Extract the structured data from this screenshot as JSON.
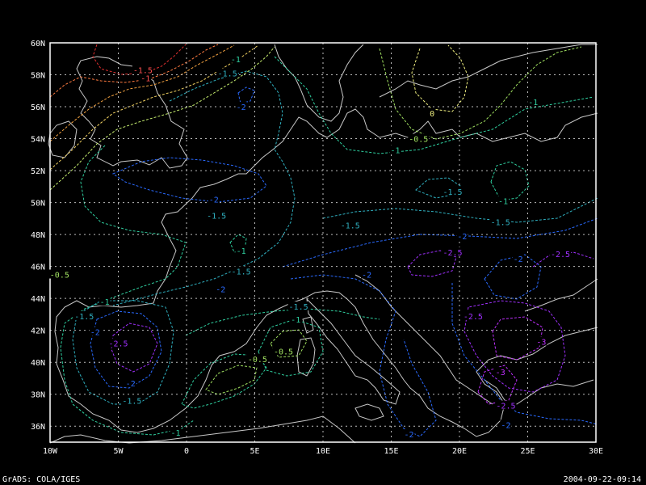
{
  "map": {
    "lon_labels": [
      "10W",
      "5W",
      "0",
      "5E",
      "10E",
      "15E",
      "20E",
      "25E",
      "30E"
    ],
    "lat_labels": [
      "60N",
      "58N",
      "56N",
      "54N",
      "52N",
      "50N",
      "48N",
      "46N",
      "44N",
      "42N",
      "40N",
      "38N",
      "36N"
    ],
    "contour_labels": [
      {
        "text": "-1.5",
        "color": "#ff5050",
        "lon": -3.2,
        "lat": 58.3
      },
      {
        "text": "-1",
        "color": "#ff5050",
        "lon": -3.0,
        "lat": 57.8
      },
      {
        "text": "-1",
        "color": "#2fd0a0",
        "lon": 3.6,
        "lat": 59.0
      },
      {
        "text": "-1.5",
        "color": "#2fb0c0",
        "lon": 3.0,
        "lat": 58.1
      },
      {
        "text": "-2",
        "color": "#2a6aff",
        "lon": 4.0,
        "lat": 56.0
      },
      {
        "text": "0",
        "color": "#f0f080",
        "lon": 18.0,
        "lat": 55.6
      },
      {
        "text": "-0.5",
        "color": "#a0e060",
        "lon": 17.0,
        "lat": 54.0
      },
      {
        "text": "-1",
        "color": "#2fd0a0",
        "lon": 15.3,
        "lat": 53.3
      },
      {
        "text": "-1",
        "color": "#2fd0a0",
        "lon": 25.4,
        "lat": 56.3
      },
      {
        "text": "-2",
        "color": "#2a6aff",
        "lon": 2.0,
        "lat": 50.2
      },
      {
        "text": "-1.5",
        "color": "#2fb0c0",
        "lon": 2.2,
        "lat": 49.2
      },
      {
        "text": "-1.5",
        "color": "#2fb0c0",
        "lon": 19.5,
        "lat": 50.7
      },
      {
        "text": "-1",
        "color": "#2fd0a0",
        "lon": 23.2,
        "lat": 50.1
      },
      {
        "text": "-1.5",
        "color": "#2fb0c0",
        "lon": 12.0,
        "lat": 48.6
      },
      {
        "text": "-1.5",
        "color": "#2fb0c0",
        "lon": 23.0,
        "lat": 48.8
      },
      {
        "text": "-2",
        "color": "#2a6aff",
        "lon": 20.2,
        "lat": 47.9
      },
      {
        "text": "-1",
        "color": "#2fd0a0",
        "lon": 4.0,
        "lat": 47.0
      },
      {
        "text": "-1.5",
        "color": "#2fb0c0",
        "lon": 4.0,
        "lat": 45.7
      },
      {
        "text": "-2.5",
        "color": "#a030ff",
        "lon": 19.5,
        "lat": 46.9
      },
      {
        "text": "-2",
        "color": "#2a6aff",
        "lon": 24.3,
        "lat": 46.5
      },
      {
        "text": "-2.5",
        "color": "#a030ff",
        "lon": 27.4,
        "lat": 46.8
      },
      {
        "text": "-0.5",
        "color": "#a0e060",
        "lon": -9.3,
        "lat": 45.5
      },
      {
        "text": "-2",
        "color": "#2a6aff",
        "lon": 13.2,
        "lat": 45.5
      },
      {
        "text": "-2",
        "color": "#2a6aff",
        "lon": 2.5,
        "lat": 44.6
      },
      {
        "text": "-1",
        "color": "#2fd0a0",
        "lon": -6.0,
        "lat": 43.8
      },
      {
        "text": "-1.5",
        "color": "#2fb0c0",
        "lon": -7.5,
        "lat": 42.9
      },
      {
        "text": "-2",
        "color": "#2a6aff",
        "lon": -6.7,
        "lat": 41.9
      },
      {
        "text": "-1.5",
        "color": "#2fb0c0",
        "lon": 8.2,
        "lat": 43.5
      },
      {
        "text": "-1",
        "color": "#2fd0a0",
        "lon": 8.0,
        "lat": 42.7
      },
      {
        "text": "-2.5",
        "color": "#a030ff",
        "lon": -5.0,
        "lat": 41.2
      },
      {
        "text": "-2.5",
        "color": "#a030ff",
        "lon": 21.0,
        "lat": 42.9
      },
      {
        "text": "-0.5",
        "color": "#a0e060",
        "lon": 7.1,
        "lat": 40.7
      },
      {
        "text": "-0.5",
        "color": "#a0e060",
        "lon": 5.2,
        "lat": 40.2
      },
      {
        "text": "-3",
        "color": "#c030ff",
        "lon": 26.0,
        "lat": 41.3
      },
      {
        "text": "-3",
        "color": "#c030ff",
        "lon": 23.0,
        "lat": 39.4
      },
      {
        "text": "-2",
        "color": "#2a6aff",
        "lon": -4.1,
        "lat": 38.7
      },
      {
        "text": "-1.5",
        "color": "#2fb0c0",
        "lon": -4.0,
        "lat": 37.6
      },
      {
        "text": "-2.5",
        "color": "#a030ff",
        "lon": 23.4,
        "lat": 37.3
      },
      {
        "text": "-2",
        "color": "#2a6aff",
        "lon": 23.4,
        "lat": 36.1
      },
      {
        "text": "-1",
        "color": "#2fd0a0",
        "lon": -0.8,
        "lat": 35.6
      },
      {
        "text": "-2",
        "color": "#2a6aff",
        "lon": 16.3,
        "lat": 35.5
      }
    ]
  },
  "footer": {
    "left": "GrADS: COLA/IGES",
    "right": "2004-09-22-09:14"
  }
}
